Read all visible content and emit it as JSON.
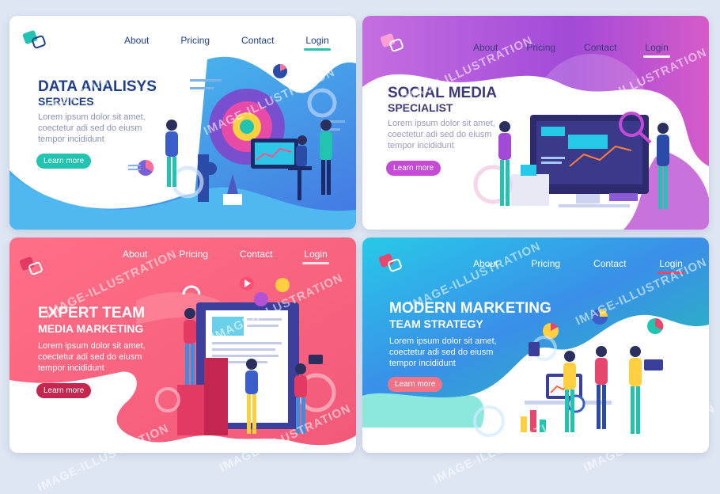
{
  "nav": {
    "about": "About",
    "pricing": "Pricing",
    "contact": "Contact",
    "login": "Login"
  },
  "cards": [
    {
      "title": "DATA ANALISYS",
      "subtitle": "SERVICES",
      "text": "Lorem ipsum dolor sit amet, coectetur adi sed do eiusm tempor incididunt",
      "button": "Learn more"
    },
    {
      "title": "SOCIAL MEDIA",
      "subtitle": "SPECIALIST",
      "text": "Lorem ipsum dolor sit amet, coectetur adi sed do eiusm tempor incididunt",
      "button": "Learn more"
    },
    {
      "title": "EXPERT TEAM",
      "subtitle": "MEDIA MARKETING",
      "text": "Lorem ipsum dolor sit amet, coectetur adi sed do eiusm tempor incididunt",
      "button": "Learn more"
    },
    {
      "title": "MODERN MARKETING",
      "subtitle": "TEAM STRATEGY",
      "text": "Lorem ipsum dolor sit amet, coectetur adi sed do eiusm tempor incididunt",
      "button": "Learn more"
    }
  ],
  "watermark": "IMAGE-ILLUSTRATION",
  "colors": {
    "teal": "#23c3b1",
    "blue": "#1f3f8a",
    "purple": "#a24ad8",
    "pink": "#e6476d",
    "coral": "#f07485",
    "cyan": "#27c9e8"
  }
}
